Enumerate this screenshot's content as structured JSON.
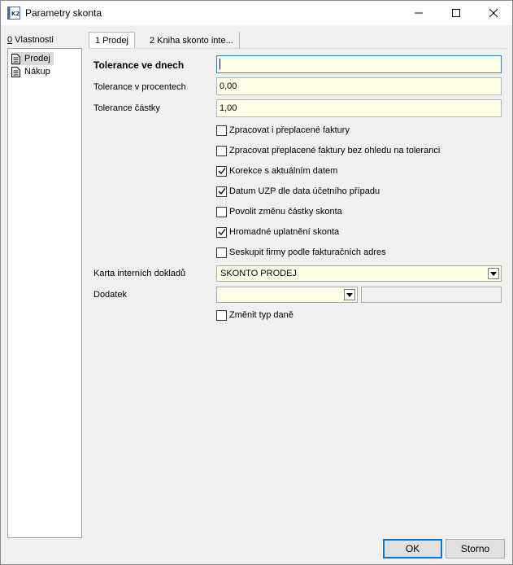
{
  "window": {
    "title": "Parametry skonta"
  },
  "left_panel": {
    "header_accel": "0",
    "header_rest": " Vlastnosti",
    "items": [
      {
        "label": "Prodej",
        "selected": true
      },
      {
        "label": "Nákup",
        "selected": false
      }
    ]
  },
  "tabs": [
    {
      "label": "1 Prodej",
      "active": true
    },
    {
      "label": "2 Kniha skonto inte...",
      "active": false
    }
  ],
  "form": {
    "tolerance_days_label": "Tolerance ve dnech",
    "tolerance_days_value": "",
    "tolerance_percent_label": "Tolerance v procentech",
    "tolerance_percent_value": "0,00",
    "tolerance_amount_label": "Tolerance částky",
    "tolerance_amount_value": "1,00",
    "checkboxes": [
      {
        "label": "Zpracovat i přeplacené faktury",
        "checked": false
      },
      {
        "label": "Zpracovat přeplacené faktury bez ohledu na toleranci",
        "checked": false
      },
      {
        "label": "Korekce s aktuálním datem",
        "checked": true
      },
      {
        "label": "Datum UZP dle data účetního případu",
        "checked": true
      },
      {
        "label": "Povolit změnu částky skonta",
        "checked": false
      },
      {
        "label": "Hromadné uplatnění skonta",
        "checked": true
      },
      {
        "label": "Seskupit firmy podle fakturačních adres",
        "checked": false
      }
    ],
    "internal_docs_label": "Karta interních dokladů",
    "internal_docs_value": "SKONTO PRODEJ",
    "addendum_label": "Dodatek",
    "addendum_value": "",
    "change_tax_type": {
      "label": "Změnit typ daně",
      "checked": false
    }
  },
  "buttons": {
    "ok": "OK",
    "cancel": "Storno"
  },
  "colors": {
    "field_bg": "#ffffe8",
    "accent": "#0078d7"
  }
}
